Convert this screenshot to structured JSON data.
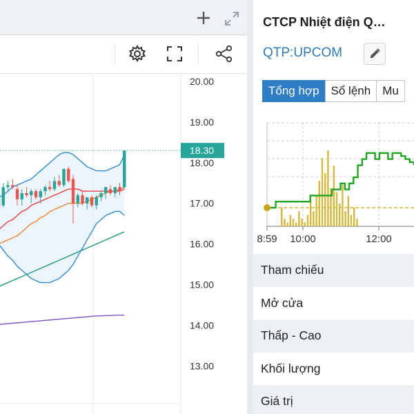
{
  "chart_panel": {
    "buttons": {
      "add": "+",
      "expand": "expand-icon",
      "settings": "gear-icon",
      "fullscreen": "fullscreen-icon",
      "share": "share-icon"
    },
    "price_axis": [
      "20.00",
      "19.00",
      "18.00",
      "17.00",
      "16.00",
      "15.00",
      "14.00",
      "13.00"
    ],
    "last_price_label": "18.30"
  },
  "chart_data": [
    {
      "type": "candlestick",
      "y_ticks": [
        20,
        19,
        18,
        17,
        16,
        15,
        14,
        13
      ],
      "y_range": [
        12.6,
        20.1
      ],
      "last_price": 18.3,
      "candles": [
        {
          "o": 17.15,
          "h": 17.3,
          "l": 16.85,
          "c": 16.9
        },
        {
          "o": 16.95,
          "h": 17.5,
          "l": 16.9,
          "c": 17.4
        },
        {
          "o": 17.4,
          "h": 17.55,
          "l": 17.3,
          "c": 17.45
        },
        {
          "o": 17.45,
          "h": 17.6,
          "l": 17.35,
          "c": 17.4
        },
        {
          "o": 17.35,
          "h": 17.45,
          "l": 16.95,
          "c": 17.1
        },
        {
          "o": 17.1,
          "h": 17.35,
          "l": 16.95,
          "c": 17.25
        },
        {
          "o": 17.25,
          "h": 17.4,
          "l": 17.15,
          "c": 17.2
        },
        {
          "o": 17.2,
          "h": 17.35,
          "l": 17.0,
          "c": 17.3
        },
        {
          "o": 17.3,
          "h": 17.35,
          "l": 17.1,
          "c": 17.15
        },
        {
          "o": 17.15,
          "h": 17.35,
          "l": 17.0,
          "c": 17.3
        },
        {
          "o": 17.3,
          "h": 17.45,
          "l": 17.2,
          "c": 17.4
        },
        {
          "o": 17.4,
          "h": 17.55,
          "l": 17.3,
          "c": 17.35
        },
        {
          "o": 17.35,
          "h": 17.65,
          "l": 17.3,
          "c": 17.55
        },
        {
          "o": 17.55,
          "h": 17.7,
          "l": 17.4,
          "c": 17.45
        },
        {
          "o": 17.45,
          "h": 17.85,
          "l": 17.4,
          "c": 17.85
        },
        {
          "o": 17.85,
          "h": 17.9,
          "l": 17.5,
          "c": 17.55
        },
        {
          "o": 17.6,
          "h": 17.7,
          "l": 16.5,
          "c": 17.0
        },
        {
          "o": 17.0,
          "h": 17.25,
          "l": 16.9,
          "c": 17.2
        },
        {
          "o": 17.2,
          "h": 17.3,
          "l": 16.95,
          "c": 17.0
        },
        {
          "o": 17.0,
          "h": 17.15,
          "l": 16.85,
          "c": 17.15
        },
        {
          "o": 17.15,
          "h": 17.2,
          "l": 16.9,
          "c": 16.95
        },
        {
          "o": 16.95,
          "h": 17.2,
          "l": 16.85,
          "c": 17.15
        },
        {
          "o": 17.15,
          "h": 17.3,
          "l": 17.05,
          "c": 17.25
        },
        {
          "o": 17.25,
          "h": 17.4,
          "l": 17.1,
          "c": 17.4
        },
        {
          "o": 17.35,
          "h": 17.45,
          "l": 17.2,
          "c": 17.25
        },
        {
          "o": 17.25,
          "h": 17.4,
          "l": 17.15,
          "c": 17.4
        },
        {
          "o": 17.4,
          "h": 17.5,
          "l": 17.2,
          "c": 17.3
        },
        {
          "o": 17.4,
          "h": 18.3,
          "l": 17.35,
          "c": 18.3
        }
      ],
      "bollinger_upper": [
        17.15,
        17.2,
        17.3,
        17.4,
        17.45,
        17.5,
        17.55,
        17.6,
        17.7,
        17.8,
        17.9,
        18.0,
        18.1,
        18.2,
        18.25,
        18.25,
        18.2,
        18.1,
        18.0,
        17.9,
        17.85,
        17.8,
        17.8,
        17.8,
        17.85,
        17.9,
        17.95,
        18.2
      ],
      "bollinger_lower": [
        16.0,
        15.85,
        15.7,
        15.6,
        15.45,
        15.35,
        15.25,
        15.15,
        15.1,
        15.05,
        15.05,
        15.05,
        15.1,
        15.15,
        15.25,
        15.35,
        15.5,
        15.7,
        15.9,
        16.1,
        16.3,
        16.5,
        16.6,
        16.7,
        16.75,
        16.8,
        16.8,
        16.7
      ],
      "ma_fast": [
        16.35,
        16.45,
        16.55,
        16.6,
        16.7,
        16.8,
        16.85,
        16.95,
        17.0,
        17.05,
        17.1,
        17.15,
        17.2,
        17.25,
        17.3,
        17.35,
        17.35,
        17.35,
        17.3,
        17.3,
        17.3,
        17.3,
        17.3,
        17.3,
        17.3,
        17.3,
        17.3,
        17.35
      ],
      "ma_mid": [
        16.0,
        16.05,
        16.1,
        16.15,
        16.2,
        16.3,
        16.4,
        16.5,
        16.55,
        16.65,
        16.7,
        16.8,
        16.85,
        16.9,
        16.95,
        17.0,
        17.0,
        17.0,
        17.0,
        17.05,
        17.1,
        17.15,
        17.2,
        17.25,
        17.3,
        17.3,
        17.35,
        17.4
      ],
      "ma_slow": [
        14.95,
        15.0,
        15.05,
        15.1,
        15.15,
        15.2,
        15.25,
        15.3,
        15.35,
        15.4,
        15.45,
        15.5,
        15.55,
        15.6,
        15.65,
        15.7,
        15.75,
        15.8,
        15.85,
        15.9,
        15.95,
        16.0,
        16.05,
        16.1,
        16.15,
        16.2,
        16.25,
        16.3
      ],
      "ma_long": [
        14.02,
        14.03,
        14.04,
        14.05,
        14.06,
        14.07,
        14.08,
        14.09,
        14.1,
        14.11,
        14.12,
        14.13,
        14.14,
        14.15,
        14.16,
        14.17,
        14.18,
        14.19,
        14.2,
        14.21,
        14.22,
        14.23,
        14.23,
        14.24,
        14.24,
        14.25,
        14.25,
        14.25
      ],
      "colors": {
        "up": "#26a69a",
        "down": "#ef5350",
        "band": "#2d8bd6",
        "ma_fast": "#e83c3c",
        "ma_mid": "#f0822b",
        "ma_slow": "#1a9a7c",
        "ma_long": "#7a4fc4"
      }
    },
    {
      "type": "line",
      "x_labels": [
        "8:59",
        "10:00",
        "12:00"
      ],
      "reference_price": 17.5,
      "price": [
        17.5,
        17.5,
        17.6,
        17.6,
        17.6,
        17.6,
        17.6,
        17.6,
        17.6,
        17.6,
        17.7,
        17.7,
        17.7,
        17.7,
        17.7,
        17.8,
        17.8,
        17.9,
        17.8,
        17.9,
        18.0,
        18.2,
        18.3,
        18.4,
        18.4,
        18.3,
        18.4,
        18.4,
        18.3,
        18.4,
        18.4,
        18.35,
        18.3,
        18.25,
        18.2
      ],
      "volume": [
        0.25,
        0.1,
        0.05,
        0.15,
        0.1,
        0.05,
        0.2,
        0.1,
        0.05,
        0.15,
        0.35,
        0.2,
        0.4,
        0.6,
        0.9,
        0.7,
        1.0,
        0.5,
        0.8,
        0.45,
        0.3,
        0.55,
        0.2,
        0.4,
        0.15,
        0.25,
        0.1
      ],
      "colors": {
        "price": "#1fa51f",
        "volume": "#d9b93a",
        "reference": "#c9a316"
      }
    }
  ],
  "quote_panel": {
    "title": "CTCP Nhiệt điện Q…",
    "ticker": "QTP:UPCOM",
    "tabs": [
      "Tổng hợp",
      "Sổ lệnh",
      "Mu"
    ],
    "active_tab": 0,
    "rows": [
      "Tham chiếu",
      "Mở cửa",
      "Thấp - Cao",
      "Khối lượng",
      "Giá trị"
    ]
  }
}
